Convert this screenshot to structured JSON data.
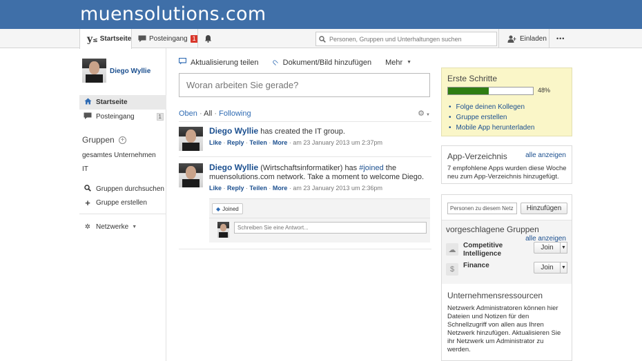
{
  "brand": "muensolutions.com",
  "nav": {
    "home": "Startseite",
    "inbox": "Posteingang",
    "inbox_count": "1",
    "search_placeholder": "Personen, Gruppen und Unterhaltungen suchen",
    "invite": "Einladen",
    "more": "•••"
  },
  "profile": {
    "name": "Diego Wyllie"
  },
  "left_nav": {
    "home": "Startseite",
    "inbox": "Posteingang",
    "inbox_count": "1",
    "groups_heading": "Gruppen",
    "group_all": "gesamtes Unternehmen",
    "group_it": "IT",
    "search_groups": "Gruppen durchsuchen",
    "create_group": "Gruppe erstellen",
    "networks": "Netzwerke"
  },
  "composer": {
    "share_update": "Aktualisierung teilen",
    "add_document": "Dokument/Bild hinzufügen",
    "more": "Mehr",
    "placeholder": "Woran arbeiten Sie gerade?"
  },
  "filters": {
    "top": "Oben",
    "sep1": "·",
    "all": "All",
    "sep2": "·",
    "following": "Following"
  },
  "posts": [
    {
      "author": "Diego Wyllie",
      "text": "has created the IT group.",
      "actions": [
        "Like",
        "Reply",
        "Teilen",
        "More"
      ],
      "timestamp": "am 23 January 2013 um 2:37pm"
    },
    {
      "author": "Diego Wyllie",
      "role": "(Wirtschaftsinformatiker) has",
      "tag": "#joined",
      "text_after": "the muensolutions.com network. Take a moment to welcome Diego.",
      "actions": [
        "Like",
        "Reply",
        "Teilen",
        "More"
      ],
      "timestamp": "am 23 January 2013 um 2:36pm",
      "topic_tag": "Joined",
      "reply_placeholder": "Schreiben Sie eine Antwort..."
    }
  ],
  "getting_started": {
    "title": "Erste Schritte",
    "progress": 48,
    "progress_label": "48%",
    "items": [
      "Folge deinen Kollegen",
      "Gruppe erstellen",
      "Mobile App herunterladen"
    ]
  },
  "app_directory": {
    "title": "App-Verzeichnis",
    "link": "alle anzeigen",
    "text": "7 empfohlene Apps wurden diese Woche neu zum App-Verzeichnis hinzugefügt."
  },
  "people": {
    "input_value": "Personen zu diesem Netz",
    "add_button": "Hinzufügen",
    "suggested_title": "vorgeschlagene Gruppen",
    "link": "alle anzeigen",
    "groups": [
      {
        "name": "Competitive Intelligence",
        "button": "Join"
      },
      {
        "name": "Finance",
        "button": "Join"
      }
    ]
  },
  "resources": {
    "title": "Unternehmensressourcen",
    "text": "Netzwerk Administratoren können hier Dateien und Notizen für den Schnellzugriff von allen aus Ihren Netzwerk hinzufügen. Aktualisieren Sie ihr Netzwerk um Administrator zu werden."
  },
  "colors": {
    "banner": "#3f6fa8",
    "link": "#1b4f8f",
    "progress": "#2f7d12",
    "badge": "#d9362a",
    "tips_bg": "#faf6c8"
  }
}
